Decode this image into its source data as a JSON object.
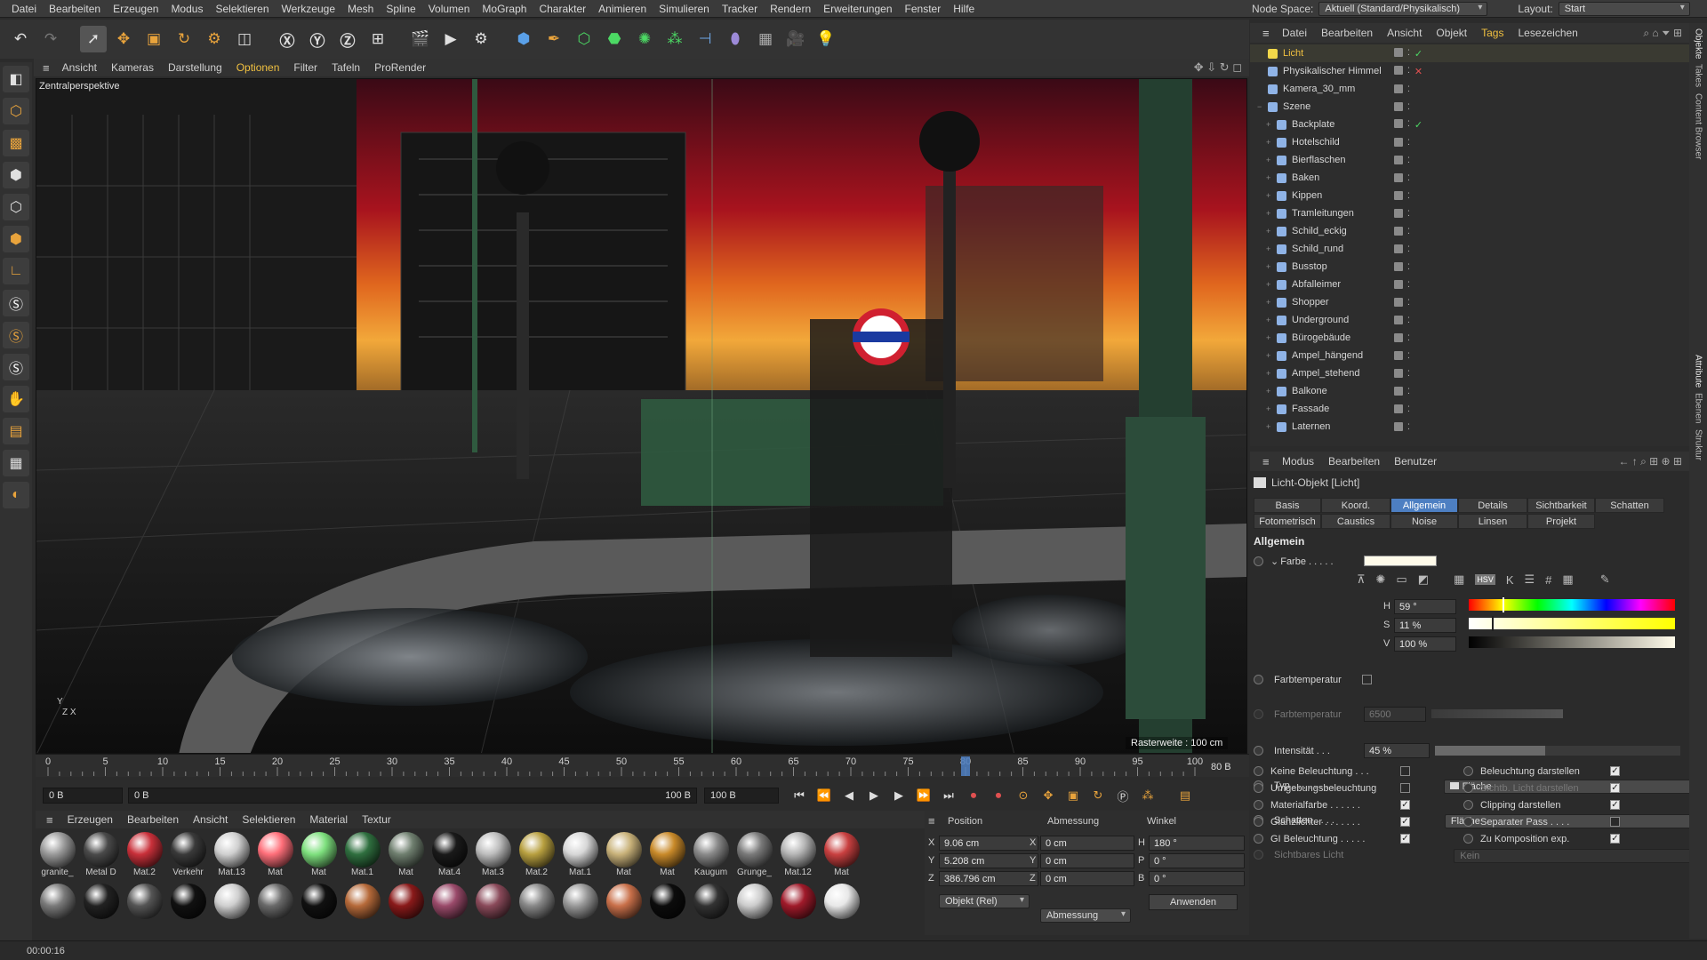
{
  "menubar": {
    "items": [
      "Datei",
      "Bearbeiten",
      "Erzeugen",
      "Modus",
      "Selektieren",
      "Werkzeuge",
      "Mesh",
      "Spline",
      "Volumen",
      "MoGraph",
      "Charakter",
      "Animieren",
      "Simulieren",
      "Tracker",
      "Rendern",
      "Erweiterungen",
      "Fenster",
      "Hilfe"
    ],
    "node_space_label": "Node Space:",
    "node_space_value": "Aktuell (Standard/Physikalisch)",
    "layout_label": "Layout:",
    "layout_value": "Start"
  },
  "viewport": {
    "menu": [
      "Ansicht",
      "Kameras",
      "Darstellung",
      "Optionen",
      "Filter",
      "Tafeln",
      "ProRender"
    ],
    "camera_label": "Zentralperspektive",
    "grid_label": "Rasterweite : 100 cm",
    "axis_y": "Y",
    "axis_zx": "Z X"
  },
  "timeline": {
    "ticks": [
      "0",
      "5",
      "10",
      "15",
      "20",
      "25",
      "30",
      "35",
      "40",
      "45",
      "50",
      "55",
      "60",
      "65",
      "70",
      "75",
      "80",
      "85",
      "90",
      "95",
      "100"
    ],
    "current_frame": "80 B",
    "current_frame_value": 80,
    "max_frame": 100,
    "start_field": "0 B",
    "start2_field": "0 B",
    "end_field": "100 B",
    "end2_field": "100 B"
  },
  "materials": {
    "menu": [
      "Erzeugen",
      "Bearbeiten",
      "Ansicht",
      "Selektieren",
      "Material",
      "Textur"
    ],
    "row1": [
      {
        "label": "granite_",
        "color": "#9a9a9a"
      },
      {
        "label": "Metal D",
        "color": "#4a4a4a"
      },
      {
        "label": "Mat.2",
        "color": "#c9303a"
      },
      {
        "label": "Verkehr",
        "color": "#3a3a3a"
      },
      {
        "label": "Mat.13",
        "color": "#d0d0d0"
      },
      {
        "label": "Mat",
        "color": "#ff6f7a"
      },
      {
        "label": "Mat",
        "color": "#7ee07e"
      },
      {
        "label": "Mat.1",
        "color": "#2f6f3f"
      },
      {
        "label": "Mat",
        "color": "#6f7f6f"
      },
      {
        "label": "Mat.4",
        "color": "#1a1a1a"
      },
      {
        "label": "Mat.3",
        "color": "#bdbdbd"
      },
      {
        "label": "Mat.2",
        "color": "#b8a040"
      },
      {
        "label": "Mat.1",
        "color": "#d7d7d7"
      },
      {
        "label": "Mat",
        "color": "#c9b27a"
      },
      {
        "label": "Mat",
        "color": "#c98a2a"
      },
      {
        "label": "Kaugum",
        "color": "#8a8a8a"
      },
      {
        "label": "Grunge_",
        "color": "#7a7a7a"
      },
      {
        "label": "Mat.12",
        "color": "#b5b5b5"
      },
      {
        "label": "Mat",
        "color": "#c94040"
      }
    ],
    "row2_colors": [
      "#7a7a7a",
      "#222",
      "#555",
      "#111",
      "#cfcfcf",
      "#6a6a6a",
      "#111",
      "#b66a3a",
      "#8a1a1a",
      "#9a4a6a",
      "#8a4a5a",
      "#888",
      "#999",
      "#c9704a",
      "#0c0c0c",
      "#333",
      "#ccc",
      "#a01a2a",
      "#e8e8e8"
    ]
  },
  "coords": {
    "headers": [
      "Position",
      "Abmessung",
      "Winkel"
    ],
    "x_pos": "9.06 cm",
    "y_pos": "5.208 cm",
    "z_pos": "386.796 cm",
    "x_size": "0 cm",
    "y_size": "0 cm",
    "z_size": "0 cm",
    "h_angle": "180 °",
    "p_angle": "0 °",
    "b_angle": "0 °",
    "mode": "Objekt (Rel)",
    "size_mode": "Abmessung",
    "apply": "Anwenden",
    "labels": {
      "x": "X",
      "y": "Y",
      "z": "Z",
      "h": "H",
      "p": "P",
      "b": "B"
    }
  },
  "status": {
    "time": "00:00:16"
  },
  "object_manager": {
    "menu": [
      "Datei",
      "Bearbeiten",
      "Ansicht",
      "Objekt",
      "Tags",
      "Lesezeichen"
    ],
    "objects": [
      {
        "name": "Licht",
        "highlight": true,
        "indent": 0
      },
      {
        "name": "Physikalischer Himmel",
        "indent": 0
      },
      {
        "name": "Kamera_30_mm",
        "indent": 0
      },
      {
        "name": "Szene",
        "indent": 0
      },
      {
        "name": "Backplate",
        "indent": 1
      },
      {
        "name": "Hotelschild",
        "indent": 1
      },
      {
        "name": "Bierflaschen",
        "indent": 1
      },
      {
        "name": "Baken",
        "indent": 1
      },
      {
        "name": "Kippen",
        "indent": 1
      },
      {
        "name": "Tramleitungen",
        "indent": 1
      },
      {
        "name": "Schild_eckig",
        "indent": 1
      },
      {
        "name": "Schild_rund",
        "indent": 1
      },
      {
        "name": "Busstop",
        "indent": 1
      },
      {
        "name": "Abfalleimer",
        "indent": 1
      },
      {
        "name": "Shopper",
        "indent": 1
      },
      {
        "name": "Underground",
        "indent": 1
      },
      {
        "name": "Bürogebäude",
        "indent": 1
      },
      {
        "name": "Ampel_hängend",
        "indent": 1
      },
      {
        "name": "Ampel_stehend",
        "indent": 1
      },
      {
        "name": "Balkone",
        "indent": 1
      },
      {
        "name": "Fassade",
        "indent": 1
      },
      {
        "name": "Laternen",
        "indent": 1
      }
    ]
  },
  "attributes": {
    "menu": [
      "Modus",
      "Bearbeiten",
      "Benutzer"
    ],
    "object_title": "Licht-Objekt [Licht]",
    "tabs_row1": [
      "Basis",
      "Koord.",
      "Allgemein",
      "Details",
      "Sichtbarkeit",
      "Schatten"
    ],
    "tabs_row2": [
      "Fotometrisch",
      "Caustics",
      "Noise",
      "Linsen",
      "Projekt"
    ],
    "section": "Allgemein",
    "farbe_label": "Farbe . . . . .",
    "h_label": "H",
    "h_value": "59 °",
    "s_label": "S",
    "s_value": "11 %",
    "v_label": "V",
    "v_value": "100 %",
    "farbtemp_label": "Farbtemperatur",
    "farbtemp2_label": "Farbtemperatur",
    "farbtemp_value": "6500",
    "intensitaet_label": "Intensität . . .",
    "intensitaet_value": "45 %",
    "intensitaet_fraction": 0.45,
    "typ_label": "Typ . . . . . . . .",
    "typ_value": "Fläche",
    "schatten_label": "Schatten . . . .",
    "schatten_value": "Fläche",
    "sichtbar_label": "Sichtbares Licht",
    "sichtbar_value": "Kein",
    "left_checks": [
      {
        "label": "Keine Beleuchtung . . .",
        "on": false
      },
      {
        "label": "Umgebungsbeleuchtung",
        "on": false
      },
      {
        "label": "Materialfarbe . . . . . .",
        "on": true
      },
      {
        "label": "Glanzlichter . . . . . . .",
        "on": true
      },
      {
        "label": "GI Beleuchtung . . . . .",
        "on": true
      }
    ],
    "right_checks": [
      {
        "label": "Beleuchtung darstellen",
        "on": true
      },
      {
        "label": "Sichtb. Licht darstellen",
        "on": true,
        "dim": true
      },
      {
        "label": "Clipping darstellen",
        "on": true
      },
      {
        "label": "Separater Pass . . . .",
        "on": false
      },
      {
        "label": "Zu Komposition exp.",
        "on": true
      }
    ]
  },
  "side_tabs": [
    "Objekte",
    "Takes",
    "Content Browser",
    "Attribute",
    "Ebenen",
    "Struktur"
  ],
  "colors": {
    "accent": "#4d7fc2",
    "highlight": "#f0c040",
    "panel": "#2b2b2b"
  }
}
